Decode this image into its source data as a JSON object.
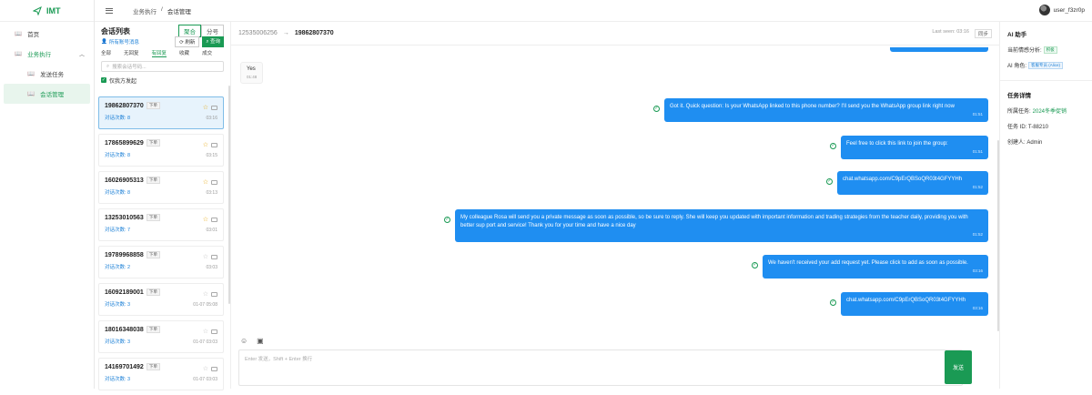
{
  "app": {
    "name": "IMT",
    "user": "user_f3zr0p"
  },
  "nav": {
    "home": "首页",
    "business": "业务执行",
    "send_task": "发送任务",
    "session_mgmt": "会话管理"
  },
  "breadcrumb": {
    "parent": "业务执行",
    "sep": "/",
    "current": "会话管理"
  },
  "list": {
    "title": "会话列表",
    "mode_aggregate": "聚合",
    "mode_split": "分号",
    "filter_link": "所有账号消息",
    "refresh": "刷新",
    "query": "查询",
    "tabs": [
      "全部",
      "无回复",
      "有回复",
      "收藏",
      "成交"
    ],
    "search_placeholder": "搜索会话号码...",
    "only_mine": "仅我方发起",
    "sessions": [
      {
        "phone": "19862807370",
        "tag": "下单",
        "count": "对话次数: 8",
        "time": "03:16",
        "starred": true,
        "selected": true
      },
      {
        "phone": "17865899629",
        "tag": "下单",
        "count": "对话次数: 8",
        "time": "03:15",
        "starred": true
      },
      {
        "phone": "16026905313",
        "tag": "下单",
        "count": "对话次数: 8",
        "time": "03:13",
        "starred": true
      },
      {
        "phone": "13253010563",
        "tag": "下单",
        "count": "对话次数: 7",
        "time": "03:01",
        "starred": true
      },
      {
        "phone": "19789968858",
        "tag": "下单",
        "count": "对话次数: 2",
        "time": "03:03",
        "starred": false
      },
      {
        "phone": "16092189001",
        "tag": "下单",
        "count": "对话次数: 3",
        "time": "01-07 05:08",
        "starred": false
      },
      {
        "phone": "18016348038",
        "tag": "下单",
        "count": "对话次数: 3",
        "time": "01-07 03:03",
        "starred": false
      },
      {
        "phone": "14169701492",
        "tag": "下单",
        "count": "对话次数: 3",
        "time": "01-07 03:03",
        "starred": false
      }
    ]
  },
  "chat": {
    "from": "12535006256",
    "arrow": "→",
    "to": "19862807370",
    "last_seen": "Last seen: 03:16",
    "sync": "同步",
    "incoming": {
      "text": "Yes",
      "time": "01:48"
    },
    "outgoing": [
      {
        "text": "Got it. Quick question: Is your WhatsApp linked to this phone number? I'll send you the WhatsApp group link right now",
        "time": "01:51"
      },
      {
        "text": "Feel free to click this link to join the group:",
        "time": "01:51"
      },
      {
        "text": "chat.whatsapp.com/C9pErQBSoQR03t4GFYYHh",
        "time": "01:52"
      },
      {
        "text": "My colleague Rosa will send you a private message as soon as possible, so be sure to reply. She will keep you updated with important information and trading strategies from the teacher daily, providing you with better sup port and service! Thank you for your time and have a nice day",
        "time": "01:52"
      },
      {
        "text": "We haven't received your add request yet. Please click to add as soon as possible.",
        "time": "03:16"
      },
      {
        "text": "chat.whatsapp.com/C9pErQBSoQR03t4GFYYHh",
        "time": "03:16"
      }
    ],
    "input_placeholder": "Enter 发送，Shift + Enter 换行",
    "send": "发送"
  },
  "side": {
    "ai_title": "AI 助手",
    "emotion_label": "当前情感分析:",
    "emotion_value": "积极",
    "role_label": "AI 角色:",
    "role_value": "客服专员 (Alice)",
    "task_title": "任务详情",
    "task_label": "所属任务:",
    "task_value": "2024冬季促销",
    "task_id": "任务 ID: T-88210",
    "creator": "创建人: Admin"
  }
}
